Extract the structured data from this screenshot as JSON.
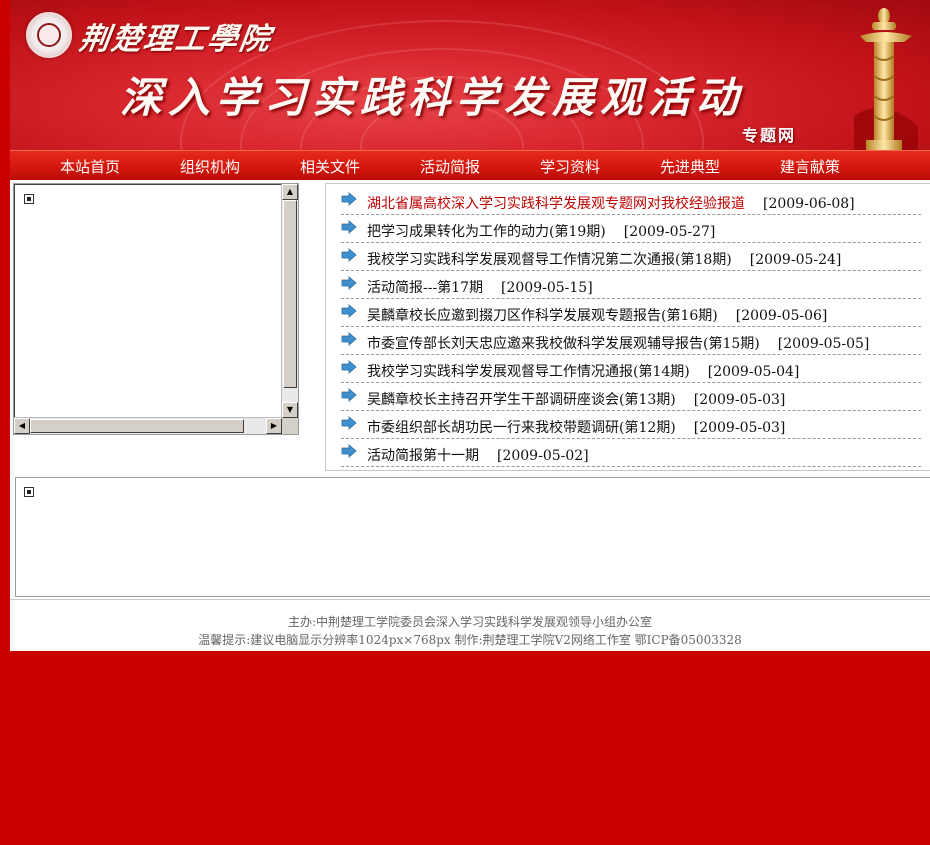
{
  "banner": {
    "school_name": "荆楚理工學院",
    "title": "深入学习实践科学发展观活动",
    "subtitle": "专题网"
  },
  "nav": {
    "items": [
      {
        "label": "本站首页"
      },
      {
        "label": "组织机构"
      },
      {
        "label": "相关文件"
      },
      {
        "label": "活动简报"
      },
      {
        "label": "学习资料"
      },
      {
        "label": "先进典型"
      },
      {
        "label": "建言献策"
      }
    ]
  },
  "news": {
    "items": [
      {
        "title": "湖北省属高校深入学习实践科学发展观专题网对我校经验报道",
        "date": "[2009-06-08]"
      },
      {
        "title": "把学习成果转化为工作的动力(第19期)",
        "date": "[2009-05-27]"
      },
      {
        "title": "我校学习实践科学发展观督导工作情况第二次通报(第18期)",
        "date": "[2009-05-24]"
      },
      {
        "title": "活动简报---第17期",
        "date": "[2009-05-15]"
      },
      {
        "title": "吴麟章校长应邀到掇刀区作科学发展观专题报告(第16期)",
        "date": "[2009-05-06]"
      },
      {
        "title": "市委宣传部长刘天忠应邀来我校做科学发展观辅导报告(第15期)",
        "date": "[2009-05-05]"
      },
      {
        "title": "我校学习实践科学发展观督导工作情况通报(第14期)",
        "date": "[2009-05-04]"
      },
      {
        "title": "吴麟章校长主持召开学生干部调研座谈会(第13期)",
        "date": "[2009-05-03]"
      },
      {
        "title": "市委组织部长胡功民一行来我校带题调研(第12期)",
        "date": "[2009-05-03]"
      },
      {
        "title": "活动简报第十一期",
        "date": "[2009-05-02]"
      }
    ]
  },
  "footer": {
    "line1": "主办:中荆楚理工学院委员会深入学习实践科学发展观领导小组办公室",
    "line2": "温馨提示:建议电脑显示分辨率1024px×768px 制作:荆楚理工学院V2网络工作室 鄂ICP备05003328"
  },
  "icons": {
    "scroll_up": "▲",
    "scroll_down": "▼",
    "scroll_left": "◀",
    "scroll_right": "▶"
  },
  "colors": {
    "brand_red": "#c80000",
    "link_red": "#c00000"
  }
}
